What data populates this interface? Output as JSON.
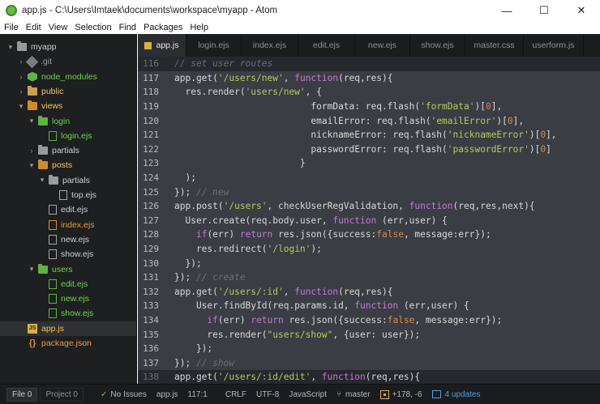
{
  "window": {
    "title": "app.js - C:\\Users\\Imtaek\\documents\\workspace\\myapp - Atom",
    "controls": [
      "—",
      "☐",
      "✕"
    ]
  },
  "menu": [
    "File",
    "Edit",
    "View",
    "Selection",
    "Find",
    "Packages",
    "Help"
  ],
  "tree": [
    {
      "label": "myapp",
      "depth": 0,
      "chev": "▾",
      "icon": "folder",
      "color": "t-white",
      "iconClass": "folder grey"
    },
    {
      "label": ".git",
      "depth": 1,
      "chev": "›",
      "icon": "git",
      "color": "t-grey",
      "iconClass": "git"
    },
    {
      "label": "node_modules",
      "depth": 1,
      "chev": "›",
      "icon": "node",
      "color": "t-green",
      "iconClass": "node"
    },
    {
      "label": "public",
      "depth": 1,
      "chev": "›",
      "icon": "folder",
      "color": "t-yellow",
      "iconClass": "folder"
    },
    {
      "label": "views",
      "depth": 1,
      "chev": "▾",
      "icon": "folder",
      "color": "t-yellow",
      "iconClass": "folder orange"
    },
    {
      "label": "login",
      "depth": 2,
      "chev": "▾",
      "icon": "folder",
      "color": "t-green",
      "iconClass": "folder green"
    },
    {
      "label": "login.ejs",
      "depth": 3,
      "chev": "",
      "icon": "file",
      "color": "t-green",
      "iconClass": "file green"
    },
    {
      "label": "partials",
      "depth": 2,
      "chev": "›",
      "icon": "folder",
      "color": "t-white",
      "iconClass": "folder grey"
    },
    {
      "label": "posts",
      "depth": 2,
      "chev": "▾",
      "icon": "folder",
      "color": "t-yellow",
      "iconClass": "folder orange"
    },
    {
      "label": "partials",
      "depth": 3,
      "chev": "▾",
      "icon": "folder",
      "color": "t-white",
      "iconClass": "folder grey"
    },
    {
      "label": "top.ejs",
      "depth": 4,
      "chev": "",
      "icon": "file",
      "color": "t-white",
      "iconClass": "file"
    },
    {
      "label": "edit.ejs",
      "depth": 3,
      "chev": "",
      "icon": "file",
      "color": "t-white",
      "iconClass": "file"
    },
    {
      "label": "index.ejs",
      "depth": 3,
      "chev": "",
      "icon": "file",
      "color": "t-orange",
      "iconClass": "file orange"
    },
    {
      "label": "new.ejs",
      "depth": 3,
      "chev": "",
      "icon": "file",
      "color": "t-white",
      "iconClass": "file"
    },
    {
      "label": "show.ejs",
      "depth": 3,
      "chev": "",
      "icon": "file",
      "color": "t-white",
      "iconClass": "file"
    },
    {
      "label": "users",
      "depth": 2,
      "chev": "▾",
      "icon": "folder",
      "color": "t-green",
      "iconClass": "folder green"
    },
    {
      "label": "edit.ejs",
      "depth": 3,
      "chev": "",
      "icon": "file",
      "color": "t-green",
      "iconClass": "file green"
    },
    {
      "label": "new.ejs",
      "depth": 3,
      "chev": "",
      "icon": "file",
      "color": "t-green",
      "iconClass": "file green"
    },
    {
      "label": "show.ejs",
      "depth": 3,
      "chev": "",
      "icon": "file",
      "color": "t-green",
      "iconClass": "file green"
    },
    {
      "label": "app.js",
      "depth": 1,
      "chev": "",
      "icon": "js",
      "color": "t-yellow",
      "iconClass": "js",
      "selected": true
    },
    {
      "label": "package.json",
      "depth": 1,
      "chev": "",
      "icon": "json",
      "color": "t-orange",
      "iconClass": "json"
    }
  ],
  "tabs": [
    {
      "label": "app.js",
      "active": true
    },
    {
      "label": "login.ejs"
    },
    {
      "label": "index.ejs"
    },
    {
      "label": "edit.ejs"
    },
    {
      "label": "new.ejs"
    },
    {
      "label": "show.ejs"
    },
    {
      "label": "master.css"
    },
    {
      "label": "userform.js"
    }
  ],
  "code": [
    {
      "n": "116",
      "hl": false,
      "dim": true,
      "t": [
        [
          "c-cmt",
          "// set user routes"
        ]
      ]
    },
    {
      "n": "117",
      "hl": true,
      "t": [
        [
          "c-ident",
          "app.get("
        ],
        [
          "c-str",
          "'/users/new'"
        ],
        [
          "c-ident",
          ", "
        ],
        [
          "c-kw",
          "function"
        ],
        [
          "c-ident",
          "(req,res){"
        ]
      ]
    },
    {
      "n": "118",
      "hl": true,
      "t": [
        [
          "c-ident",
          "  res.render("
        ],
        [
          "c-str",
          "'users/new'"
        ],
        [
          "c-ident",
          ", {"
        ]
      ]
    },
    {
      "n": "119",
      "hl": true,
      "t": [
        [
          "c-ident",
          "                         formData: req.flash("
        ],
        [
          "c-str",
          "'formData'"
        ],
        [
          "c-ident",
          ")["
        ],
        [
          "c-num",
          "0"
        ],
        [
          "c-ident",
          "],"
        ]
      ]
    },
    {
      "n": "120",
      "hl": true,
      "t": [
        [
          "c-ident",
          "                         emailError: req.flash("
        ],
        [
          "c-str",
          "'emailError'"
        ],
        [
          "c-ident",
          ")["
        ],
        [
          "c-num",
          "0"
        ],
        [
          "c-ident",
          "],"
        ]
      ]
    },
    {
      "n": "121",
      "hl": true,
      "t": [
        [
          "c-ident",
          "                         nicknameError: req.flash("
        ],
        [
          "c-str",
          "'nicknameError'"
        ],
        [
          "c-ident",
          ")["
        ],
        [
          "c-num",
          "0"
        ],
        [
          "c-ident",
          "],"
        ]
      ]
    },
    {
      "n": "122",
      "hl": true,
      "t": [
        [
          "c-ident",
          "                         passwordError: req.flash("
        ],
        [
          "c-str",
          "'passwordError'"
        ],
        [
          "c-ident",
          ")["
        ],
        [
          "c-num",
          "0"
        ],
        [
          "c-ident",
          "]"
        ]
      ]
    },
    {
      "n": "123",
      "hl": true,
      "t": [
        [
          "c-ident",
          "                       }"
        ]
      ]
    },
    {
      "n": "124",
      "hl": true,
      "t": [
        [
          "c-ident",
          "  );"
        ]
      ]
    },
    {
      "n": "125",
      "hl": true,
      "t": [
        [
          "c-ident",
          "}); "
        ],
        [
          "c-cmt",
          "// new"
        ]
      ]
    },
    {
      "n": "126",
      "hl": true,
      "t": [
        [
          "c-ident",
          "app.post("
        ],
        [
          "c-str",
          "'/users'"
        ],
        [
          "c-ident",
          ", checkUserRegValidation, "
        ],
        [
          "c-kw",
          "function"
        ],
        [
          "c-ident",
          "(req,res,next){"
        ]
      ]
    },
    {
      "n": "127",
      "hl": true,
      "t": [
        [
          "c-ident",
          "  User.create(req.body.user, "
        ],
        [
          "c-kw",
          "function"
        ],
        [
          "c-ident",
          " (err,user) {"
        ]
      ]
    },
    {
      "n": "128",
      "hl": true,
      "t": [
        [
          "c-ident",
          "    "
        ],
        [
          "c-kw",
          "if"
        ],
        [
          "c-ident",
          "(err) "
        ],
        [
          "c-kw",
          "return"
        ],
        [
          "c-ident",
          " res.json({success:"
        ],
        [
          "c-bool",
          "false"
        ],
        [
          "c-ident",
          ", message:err});"
        ]
      ]
    },
    {
      "n": "129",
      "hl": true,
      "t": [
        [
          "c-ident",
          "    res.redirect("
        ],
        [
          "c-str",
          "'/login'"
        ],
        [
          "c-ident",
          ");"
        ]
      ]
    },
    {
      "n": "130",
      "hl": true,
      "t": [
        [
          "c-ident",
          "  });"
        ]
      ]
    },
    {
      "n": "131",
      "hl": true,
      "t": [
        [
          "c-ident",
          "}); "
        ],
        [
          "c-cmt",
          "// create"
        ]
      ]
    },
    {
      "n": "132",
      "hl": true,
      "t": [
        [
          "c-ident",
          "app.get("
        ],
        [
          "c-str",
          "'/users/:id'"
        ],
        [
          "c-ident",
          ", "
        ],
        [
          "c-kw",
          "function"
        ],
        [
          "c-ident",
          "(req,res){"
        ]
      ]
    },
    {
      "n": "133",
      "hl": true,
      "t": [
        [
          "c-ident",
          "    User.findById(req.params.id, "
        ],
        [
          "c-kw",
          "function"
        ],
        [
          "c-ident",
          " (err,user) {"
        ]
      ]
    },
    {
      "n": "134",
      "hl": true,
      "t": [
        [
          "c-ident",
          "      "
        ],
        [
          "c-kw",
          "if"
        ],
        [
          "c-ident",
          "(err) "
        ],
        [
          "c-kw",
          "return"
        ],
        [
          "c-ident",
          " res.json({success:"
        ],
        [
          "c-bool",
          "false"
        ],
        [
          "c-ident",
          ", message:err});"
        ]
      ]
    },
    {
      "n": "135",
      "hl": true,
      "t": [
        [
          "c-ident",
          "      res.render("
        ],
        [
          "c-str",
          "\"users/show\""
        ],
        [
          "c-ident",
          ", {user: user});"
        ]
      ]
    },
    {
      "n": "136",
      "hl": true,
      "t": [
        [
          "c-ident",
          "    });"
        ]
      ]
    },
    {
      "n": "137",
      "hl": true,
      "t": [
        [
          "c-ident",
          "}); "
        ],
        [
          "c-cmt",
          "// show"
        ]
      ]
    },
    {
      "n": "138",
      "hl": false,
      "dim": true,
      "t": [
        [
          "c-ident",
          "app.get("
        ],
        [
          "c-str",
          "'/users/:id/edit'"
        ],
        [
          "c-ident",
          ", "
        ],
        [
          "c-kw",
          "function"
        ],
        [
          "c-ident",
          "(req,res){"
        ]
      ]
    }
  ],
  "status": {
    "file_tab": "File",
    "file_count": "0",
    "project_tab": "Project",
    "project_count": "0",
    "issues": "No Issues",
    "filename": "app.js",
    "cursor": "117:1",
    "line_ending": "CRLF",
    "encoding": "UTF-8",
    "grammar": "JavaScript",
    "branch": "master",
    "diff": "+178, -6",
    "updates": "4 updates"
  }
}
